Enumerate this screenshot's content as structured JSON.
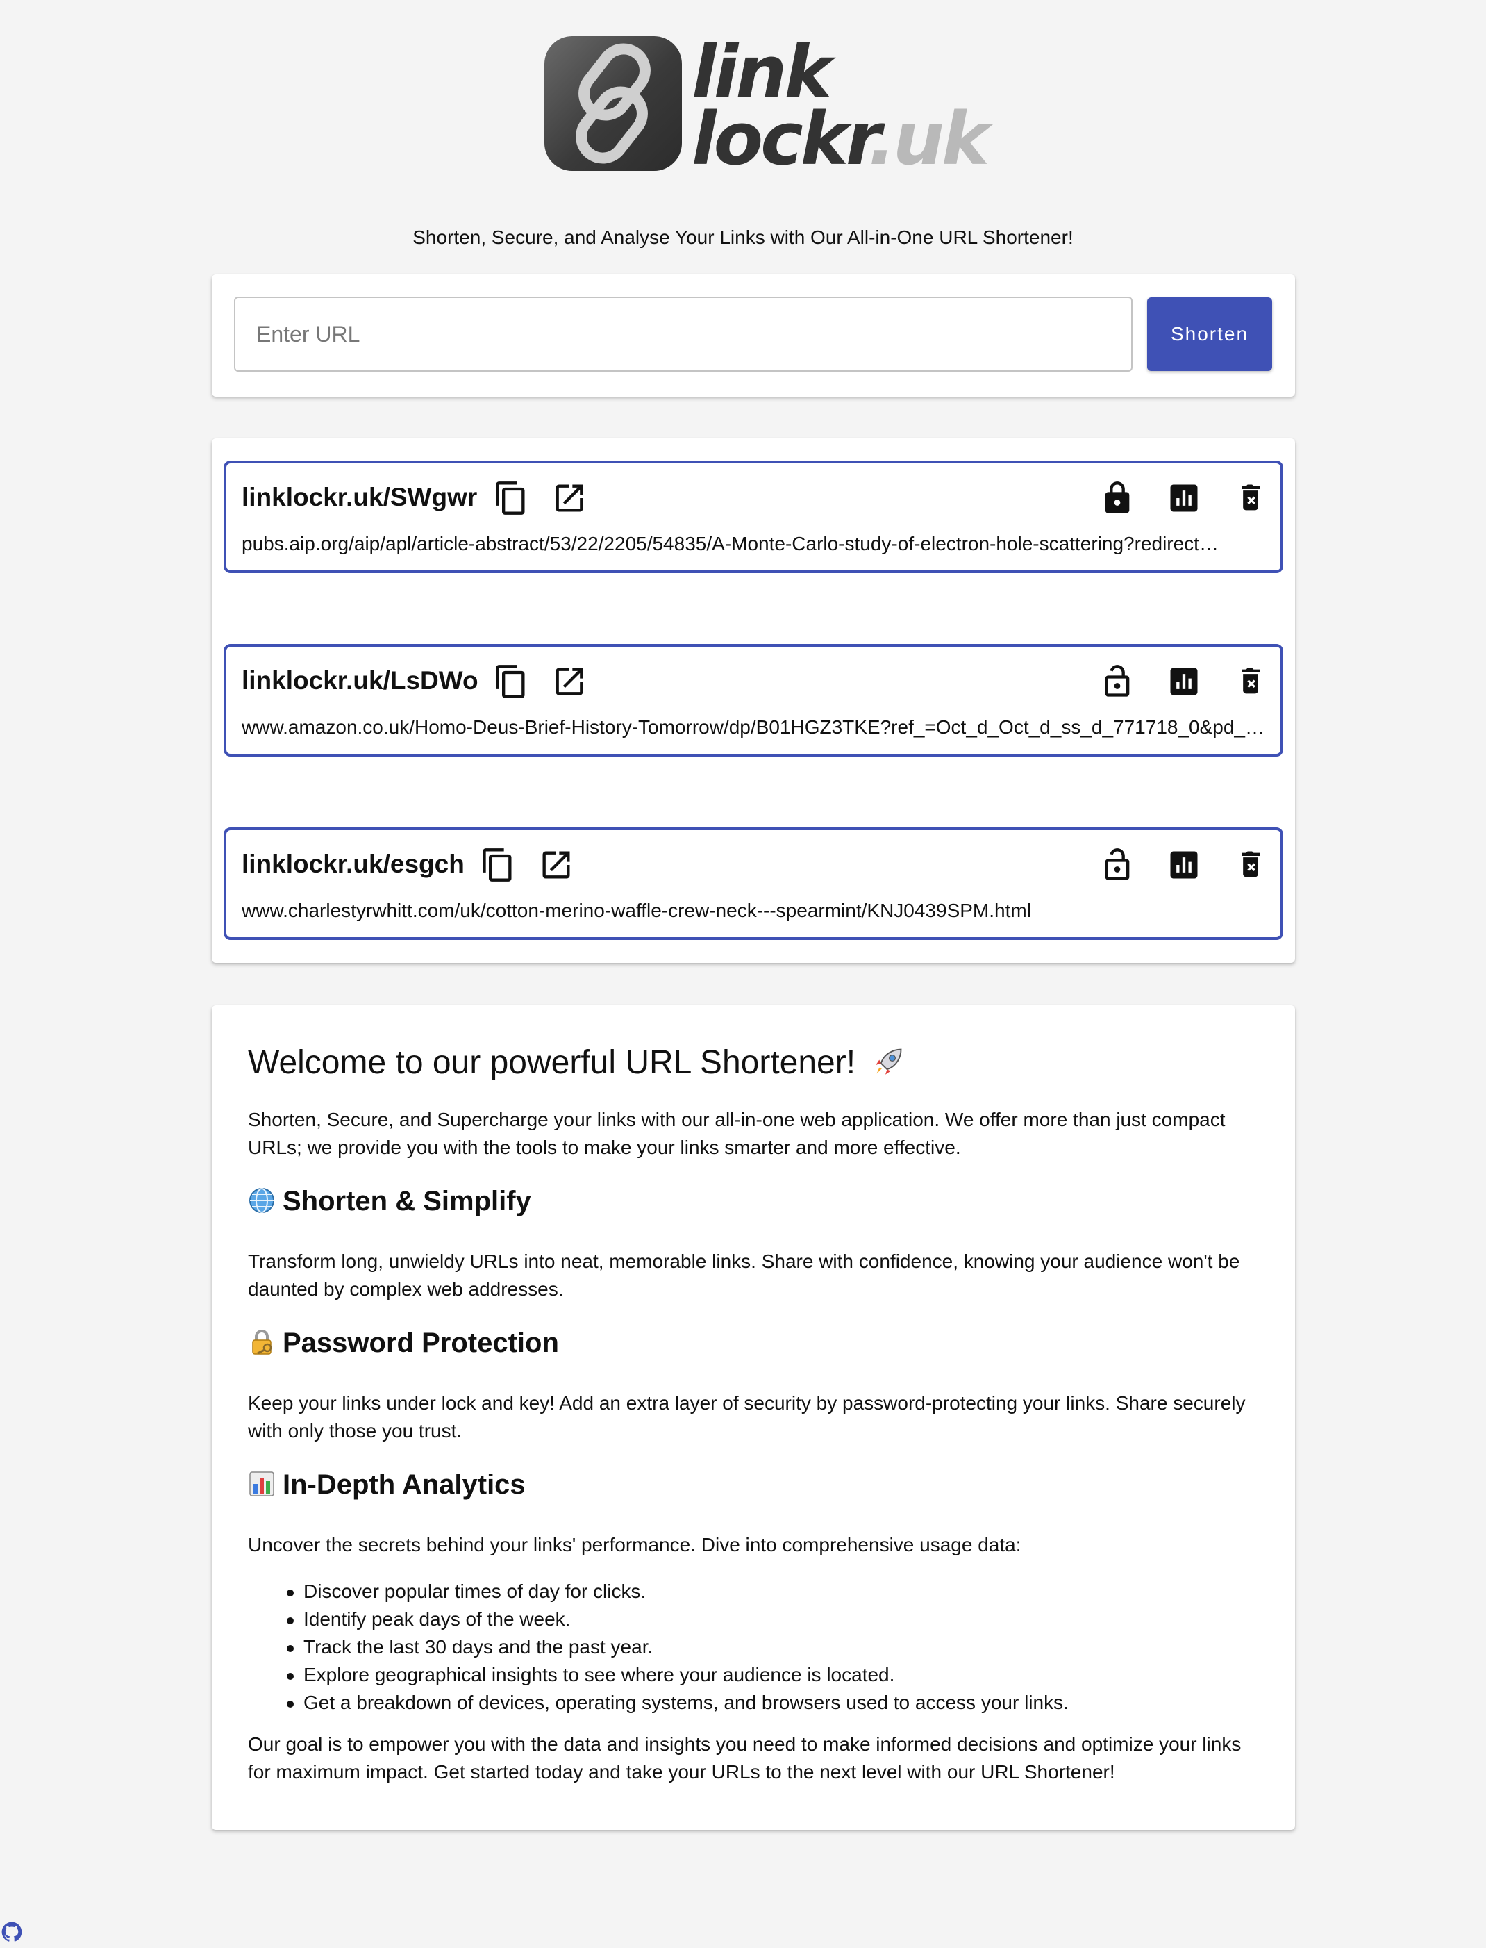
{
  "brand": {
    "logo_line1": "link",
    "logo_line2": "lockr",
    "logo_tld": ".uk",
    "logo_icon": "chain-link-icon"
  },
  "tagline": "Shorten, Secure, and Analyse Your Links with Our All-in-One URL Shortener!",
  "shortener": {
    "placeholder": "Enter URL",
    "value": "",
    "button_label": "Shorten"
  },
  "colors": {
    "accent": "#3f51b5",
    "background": "#f4f4f4"
  },
  "links": [
    {
      "short_url": "linklockr.uk/SWgwr",
      "long_url": "pubs.aip.org/aip/apl/article-abstract/53/22/2205/54835/A-Monte-Carlo-study-of-electron-hole-scattering?redirect…",
      "locked": true,
      "icons": [
        "copy-icon",
        "open-in-new-icon",
        "lock-icon",
        "analytics-icon",
        "delete-icon"
      ]
    },
    {
      "short_url": "linklockr.uk/LsDWo",
      "long_url": "www.amazon.co.uk/Homo-Deus-Brief-History-Tomorrow/dp/B01HGZ3TKE?ref_=Oct_d_Oct_d_ss_d_771718_0&pd_…",
      "locked": false,
      "icons": [
        "copy-icon",
        "open-in-new-icon",
        "lock-open-icon",
        "analytics-icon",
        "delete-icon"
      ]
    },
    {
      "short_url": "linklockr.uk/esgch",
      "long_url": "www.charlestyrwhitt.com/uk/cotton-merino-waffle-crew-neck---spearmint/KNJ0439SPM.html",
      "locked": false,
      "icons": [
        "copy-icon",
        "open-in-new-icon",
        "lock-open-icon",
        "analytics-icon",
        "delete-icon"
      ]
    }
  ],
  "info": {
    "title": "Welcome to our powerful URL Shortener!",
    "intro": "Shorten, Secure, and Supercharge your links with our all-in-one web application. We offer more than just compact URLs; we provide you with the tools to make your links smarter and more effective.",
    "section1_heading": "Shorten & Simplify",
    "section1_text": "Transform long, unwieldy URLs into neat, memorable links. Share with confidence, knowing your audience won't be daunted by complex web addresses.",
    "section2_heading": "Password Protection",
    "section2_text": "Keep your links under lock and key! Add an extra layer of security by password-protecting your links. Share securely with only those you trust.",
    "section3_heading": "In-Depth Analytics",
    "section3_text": "Uncover the secrets behind your links' performance. Dive into comprehensive usage data:",
    "analytics_items": [
      "Discover popular times of day for clicks.",
      "Identify peak days of the week.",
      "Track the last 30 days and the past year.",
      "Explore geographical insights to see where your audience is located.",
      "Get a breakdown of devices, operating systems, and browsers used to access your links."
    ],
    "closing": "Our goal is to empower you with the data and insights you need to make informed decisions and optimize your links for maximum impact. Get started today and take your URLs to the next level with our URL Shortener!"
  },
  "footer": {
    "icon": "github-icon"
  }
}
